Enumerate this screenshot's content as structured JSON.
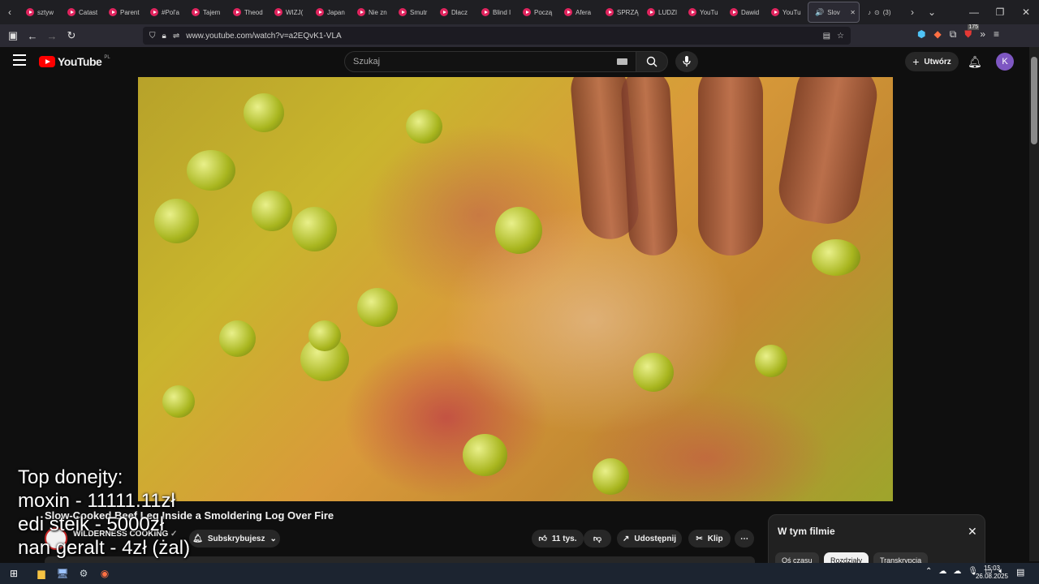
{
  "browser": {
    "tabs": [
      {
        "label": "sztyw"
      },
      {
        "label": "Catast"
      },
      {
        "label": "Parent"
      },
      {
        "label": "#Pol'a"
      },
      {
        "label": "Tajem"
      },
      {
        "label": "Theod"
      },
      {
        "label": "WIZJ("
      },
      {
        "label": "Japan"
      },
      {
        "label": "Nie zn"
      },
      {
        "label": "Smutr"
      },
      {
        "label": "Dlacz"
      },
      {
        "label": "Blind I"
      },
      {
        "label": "Począ"
      },
      {
        "label": "Afera"
      },
      {
        "label": "SPRZĄ"
      },
      {
        "label": "LUDZI"
      },
      {
        "label": "YouTu"
      },
      {
        "label": "Dawid"
      },
      {
        "label": "YouTu"
      }
    ],
    "active_tab": {
      "label": "Slov"
    },
    "next_tab": {
      "label": "(3)"
    },
    "url": "www.youtube.com/watch?v=a2EQvK1-VLA",
    "extension_badge": "175"
  },
  "youtube": {
    "logo_text": "YouTube",
    "region": "PL",
    "search_placeholder": "Szukaj",
    "create_label": "Utwórz",
    "avatar_letter": "K"
  },
  "overlay": {
    "lines": [
      "Top donejty:",
      "moxin - 11111.11zł",
      "edi steik - 5000zł",
      "nan geralt - 4zł (żal)"
    ]
  },
  "video_info": {
    "title": "Slow-Cooked Beef Leg Inside a Smoldering Log Over Fire",
    "channel": "WILDERNESS COOKING",
    "subscribe_label": "Subskrybujesz",
    "likes": "11 tys.",
    "share_label": "Udostępnij",
    "clip_label": "Klip"
  },
  "chapters_panel": {
    "title": "W tym filmie",
    "tabs": [
      "Oś czasu",
      "Rozdziały",
      "Transkrypcja"
    ]
  },
  "taskbar": {
    "time": "15:03",
    "date": "26.08.2025"
  }
}
